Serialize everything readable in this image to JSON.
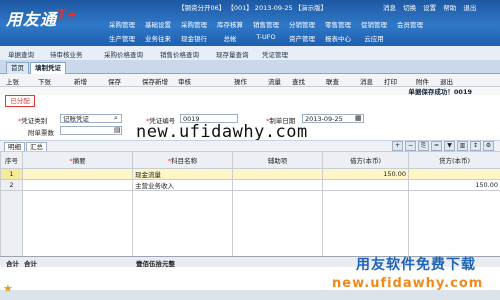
{
  "header": {
    "logo_text": "用友通",
    "logo_mark": "T+",
    "status_line": "【钢资分开06】 【001】 2013-09-25 【演示版】",
    "links": [
      "消息",
      "切换",
      "设置",
      "帮助",
      "退出"
    ],
    "nav_row1": [
      "采购管理",
      "基础设置",
      "采购管理",
      "库存核算",
      "销售管理",
      "分销管理",
      "零售管理",
      "促销管理",
      "会员管理"
    ],
    "nav_row2": [
      "生产管理",
      "业务往来",
      "现金银行",
      "总帐",
      "T-UFO",
      "资产管理",
      "报表中心",
      "云应用"
    ]
  },
  "quick_links": [
    "单据查询",
    "待审核业务",
    "采购价格查询",
    "销售价格查询",
    "现存量查询",
    "凭证管理"
  ],
  "tabs": [
    {
      "label": "首页",
      "active": false
    },
    {
      "label": "填制凭证",
      "active": true
    }
  ],
  "toolbar": [
    "上张",
    "下张",
    "新增",
    "保存",
    "保存新增",
    "审核",
    "操作",
    "流量",
    "查找",
    "联查",
    "消息",
    "打印",
    "附件",
    "退出"
  ],
  "save_message": "单据保存成功！0019",
  "stamp": "已分配",
  "form": {
    "voucher_type_label": "凭证类别",
    "voucher_type_value": "记账凭证",
    "voucher_no_label": "凭证编号",
    "voucher_no_value": "0019",
    "date_label": "制单日期",
    "date_value": "2013-09-25",
    "attachments_label": "附单票数",
    "attachments_value": ""
  },
  "watermark": "new.ufidawhy.com",
  "subtabs": [
    "明细",
    "汇总"
  ],
  "grid": {
    "headers": [
      "序号",
      "摘要",
      "科目名称",
      "辅助项",
      "借方(本币)",
      "贷方(本币)"
    ],
    "rows": [
      {
        "no": "1",
        "summary": "",
        "account": "现金流量",
        "aux": "",
        "debit": "150.00",
        "credit": ""
      },
      {
        "no": "2",
        "summary": "",
        "account": "主营业务收入",
        "aux": "",
        "debit": "",
        "credit": "150.00"
      }
    ]
  },
  "footer": {
    "total_label": "合计",
    "total_text": "合计",
    "footer_note": "壹佰伍拾元整"
  },
  "brand": {
    "slogan": "用友软件免费下载",
    "url": "new.ufidawhy.com"
  }
}
